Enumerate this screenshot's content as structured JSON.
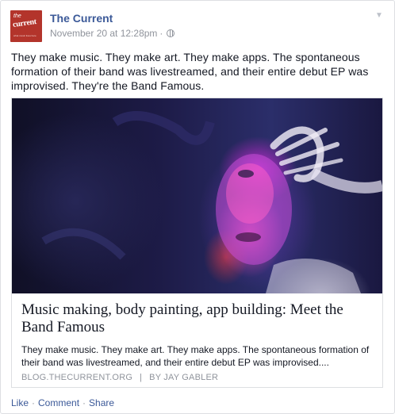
{
  "post": {
    "page_name": "The Current",
    "timestamp": "November 20 at 12:28pm",
    "meta_separator": "·",
    "privacy_icon": "globe-icon",
    "avatar": {
      "small_text": "the",
      "brand": "current",
      "tagline": "what music lives here"
    },
    "message": "They make music. They make art. They make apps. The spontaneous formation of their band was livestreamed, and their entire debut EP was improvised. They're the Band Famous."
  },
  "share": {
    "title": "Music making, body painting, app building: Meet the Band Famous",
    "description": "They make music. They make art. They make apps. The spontaneous formation of their band was livestreamed, and their entire debut EP was improvised....",
    "source": "BLOG.THECURRENT.ORG",
    "divider": "|",
    "author": "BY JAY GABLER"
  },
  "actions": {
    "like": "Like",
    "comment": "Comment",
    "share": "Share",
    "separator": "·"
  },
  "colors": {
    "link": "#3b5998",
    "meta": "#90949c",
    "text": "#141823",
    "brand": "#b3342b"
  }
}
